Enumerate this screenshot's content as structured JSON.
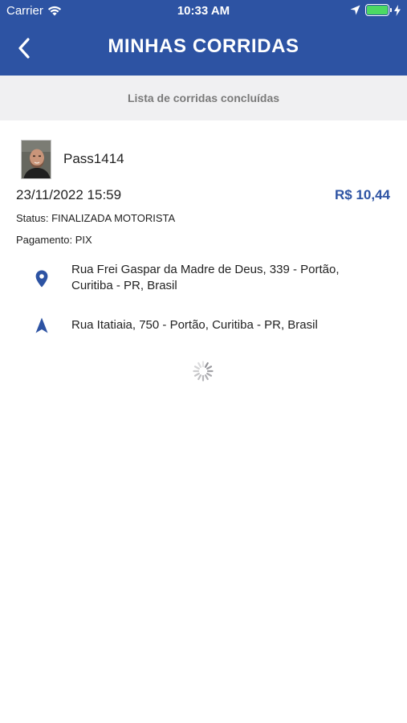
{
  "status_bar": {
    "carrier": "Carrier",
    "time": "10:33 AM",
    "battery_level": 1.0
  },
  "nav": {
    "title": "MINHAS CORRIDAS",
    "back_icon": "chevron-left-icon"
  },
  "subheader": {
    "text": "Lista de corridas concluídas"
  },
  "ride": {
    "passenger_name": "Pass1414",
    "datetime": "23/11/2022 15:59",
    "price": "R$ 10,44",
    "status": "Status: FINALIZADA MOTORISTA",
    "payment": "Pagamento: PIX",
    "origin_icon": "map-pin-icon",
    "origin_line1": "Rua Frei Gaspar da Madre de Deus, 339 - Portão,",
    "origin_line2": "Curitiba - PR, Brasil",
    "destination_icon": "navigation-arrow-icon",
    "destination": "Rua Itatiaia, 750 - Portão, Curitiba - PR, Brasil"
  },
  "loading": {
    "icon": "spinner-icon"
  },
  "colors": {
    "primary": "#2d53a3",
    "subheader_bg": "#f0f0f2",
    "battery": "#4cd964"
  }
}
